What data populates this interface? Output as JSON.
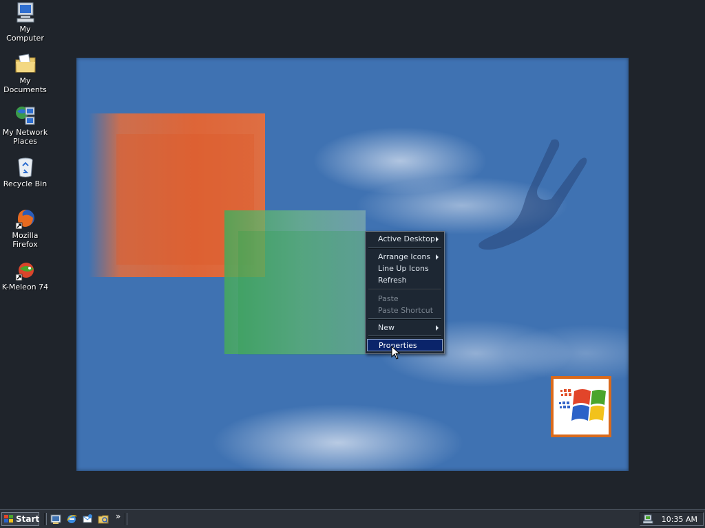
{
  "desktop": {
    "icons": [
      {
        "label": "My Computer",
        "icon": "my-computer-icon"
      },
      {
        "label": "My Documents",
        "icon": "my-documents-icon"
      },
      {
        "label": "My Network Places",
        "icon": "network-places-icon"
      },
      {
        "label": "Recycle Bin",
        "icon": "recycle-bin-icon"
      },
      {
        "label": "Mozilla Firefox",
        "icon": "firefox-icon"
      },
      {
        "label": "K-Meleon 74",
        "icon": "kmeleon-icon"
      }
    ]
  },
  "context_menu": {
    "items": [
      {
        "label": "Active Desktop",
        "submenu": true,
        "disabled": false
      },
      {
        "label": "Arrange Icons",
        "submenu": true,
        "disabled": false
      },
      {
        "label": "Line Up Icons",
        "submenu": false,
        "disabled": false
      },
      {
        "label": "Refresh",
        "submenu": false,
        "disabled": false
      },
      {
        "label": "Paste",
        "submenu": false,
        "disabled": true
      },
      {
        "label": "Paste Shortcut",
        "submenu": false,
        "disabled": true
      },
      {
        "label": "New",
        "submenu": true,
        "disabled": false
      },
      {
        "label": "Properties",
        "submenu": false,
        "disabled": false,
        "selected": true
      }
    ]
  },
  "taskbar": {
    "start_label": "Start",
    "quick_launch": [
      "show-desktop-icon",
      "internet-explorer-icon",
      "outlook-express-icon",
      "windows-explorer-icon"
    ],
    "overflow_label": "»",
    "clock": "10:35 AM"
  },
  "colors": {
    "desktop_bg": "#1f242b",
    "wallpaper_blue": "#3f72b2",
    "menu_highlight": "#0a246a",
    "taskbar_bg": "#2b3038"
  }
}
